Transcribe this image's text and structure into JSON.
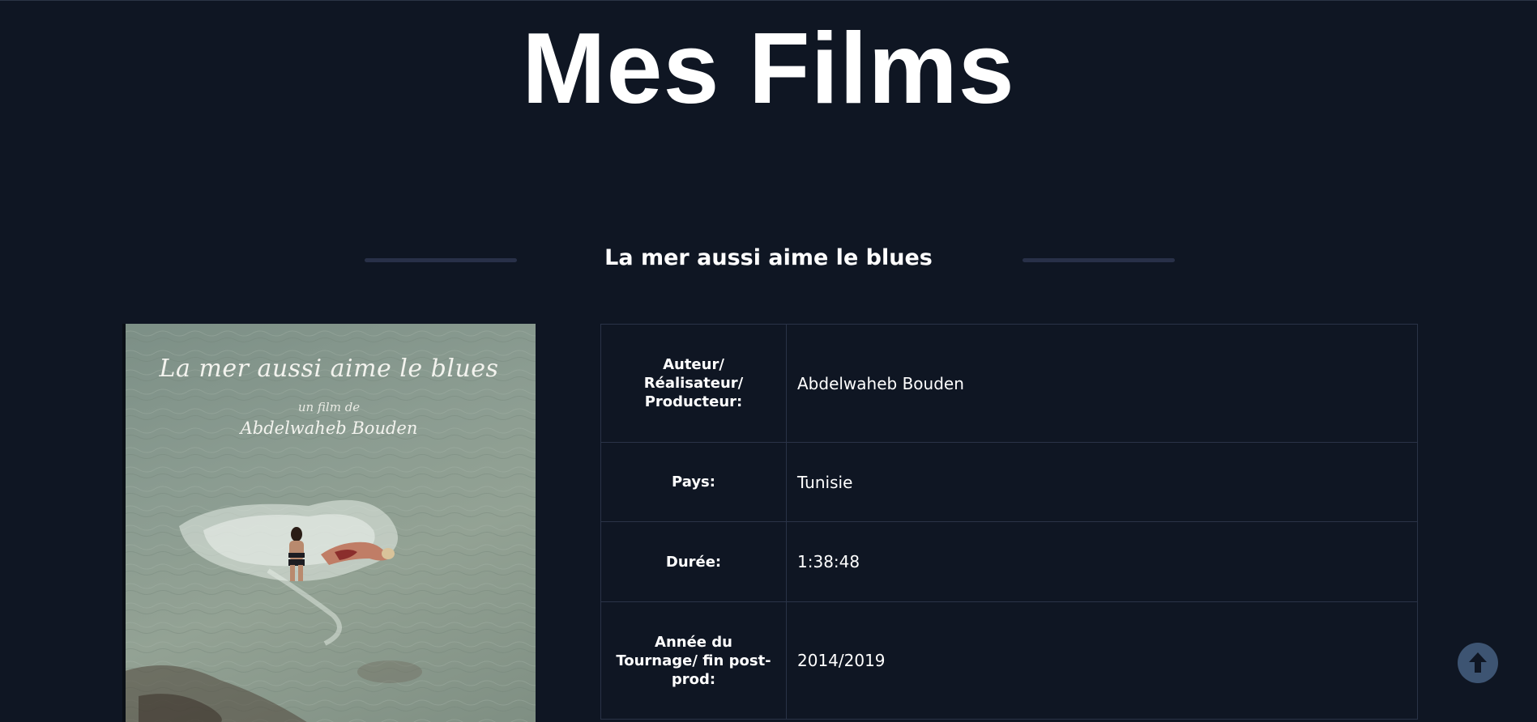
{
  "page": {
    "title": "Mes Films"
  },
  "film": {
    "title": "La mer aussi aime le blues",
    "poster": {
      "title": "La mer aussi aime le blues",
      "subtitle": "un film de",
      "director": "Abdelwaheb Bouden"
    },
    "details": [
      {
        "label": "Auteur/ Réalisateur/ Producteur:",
        "value": "Abdelwaheb Bouden"
      },
      {
        "label": "Pays:",
        "value": "Tunisie"
      },
      {
        "label": "Durée:",
        "value": "1:38:48"
      },
      {
        "label": "Année du Tournage/ fin post-prod:",
        "value": "2014/2019"
      }
    ]
  },
  "controls": {
    "scroll_top_icon": "arrow-up-icon"
  },
  "colors": {
    "background": "#0f1623",
    "divider": "#283048",
    "table_border": "#2a3347",
    "scroll_button": "#3d5472"
  }
}
